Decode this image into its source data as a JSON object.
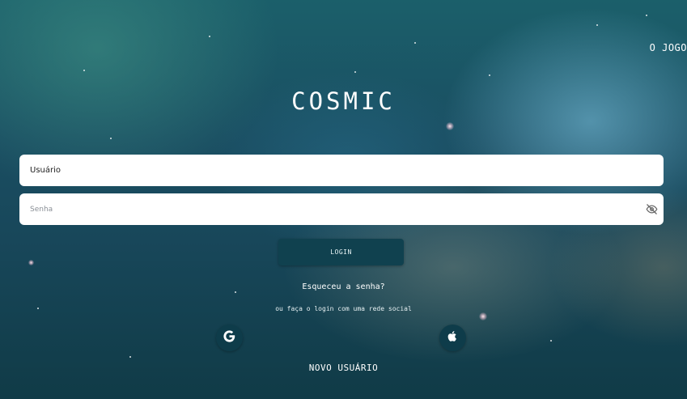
{
  "nav": {
    "game_link": "O JOGO"
  },
  "logo": {
    "text": "COSMIC"
  },
  "form": {
    "username_value": "Usuário",
    "password_placeholder": "Senha",
    "login_label": "LOGIN"
  },
  "links": {
    "forgot_password": "Esqueceu a senha?",
    "social_prompt": "ou faça o login com uma rede social",
    "new_user": "NOVO USUÁRIO"
  },
  "social": {
    "google_icon": "google-icon",
    "apple_icon": "apple-icon"
  },
  "colors": {
    "button_bg": "#10414f",
    "social_bg": "#0e3c4a",
    "field_bg": "#ffffff"
  }
}
